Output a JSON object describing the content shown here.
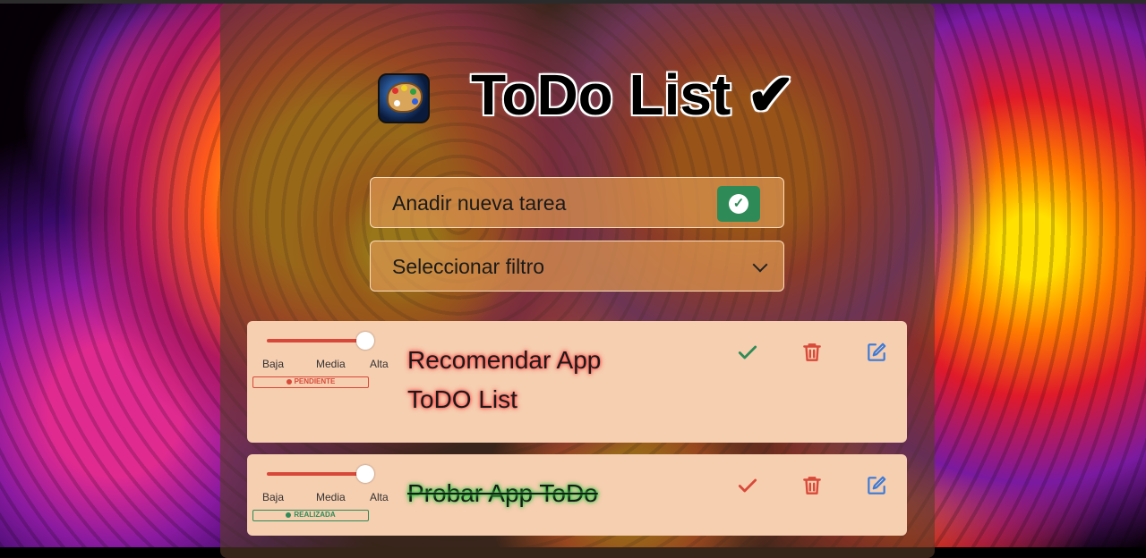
{
  "app": {
    "title": "ToDo List ✔"
  },
  "add_task": {
    "label": "Anadir nueva tarea"
  },
  "filter": {
    "selected": "Seleccionar filtro"
  },
  "priority_labels": [
    "Baja",
    "Media",
    "Alta"
  ],
  "tasks": [
    {
      "text": "Recomendar App ToDO List",
      "status": "PENDIENTE",
      "priority": "Alta",
      "completed": false
    },
    {
      "text": "Probar App ToDo",
      "status": "REALIZADA",
      "priority": "Alta",
      "completed": true
    }
  ],
  "icons": {
    "complete": "check-icon",
    "delete": "trash-icon",
    "edit": "edit-icon"
  },
  "colors": {
    "add_button": "#2e8b57",
    "pending": "#d84a3a",
    "done": "#2e8b57",
    "slider": "#d8483a",
    "card_bg": "#f6ceb0",
    "edit_icon": "#3a7ad8"
  }
}
